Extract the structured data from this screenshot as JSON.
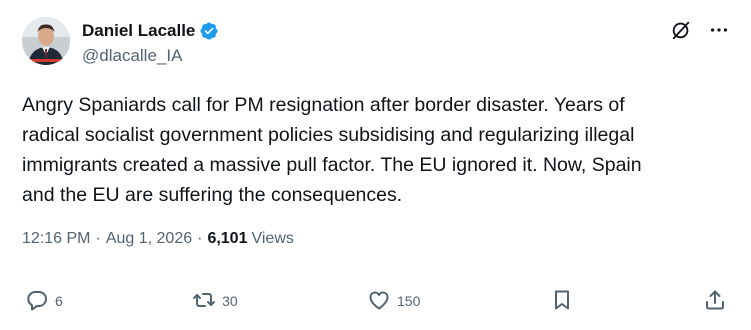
{
  "author": {
    "display_name": "Daniel Lacalle",
    "handle": "@dlacalle_IA",
    "verified": true,
    "avatar_icon": "profile-photo"
  },
  "tweet": {
    "text": "Angry Spaniards call for PM resignation after border disaster. Years of\nradical socialist government policies subsidising and regularizing illegal\nimmigrants created a massive pull factor. The EU ignored it. Now, Spain\nand the EU are suffering the consequences.",
    "time": "12:16 PM",
    "date": "Aug 1, 2026",
    "separator": "·",
    "views_count": "6,101",
    "views_label": "Views"
  },
  "actions": {
    "reply_count": "6",
    "retweet_count": "30",
    "like_count": "150"
  },
  "icons": {
    "verified": "verified-badge-icon",
    "grok": "grok-icon",
    "more": "more-icon",
    "reply": "reply-icon",
    "retweet": "retweet-icon",
    "like": "like-icon",
    "bookmark": "bookmark-icon",
    "share": "share-icon"
  },
  "colors": {
    "text": "#0f1419",
    "secondary": "#536471",
    "verified": "#1d9bf0",
    "background": "#ffffff"
  }
}
